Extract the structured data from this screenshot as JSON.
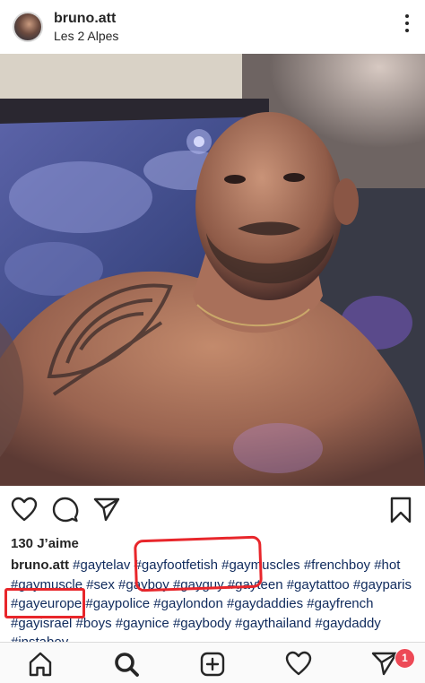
{
  "post": {
    "username": "bruno.att",
    "location": "Les 2 Alpes",
    "likes": "130 J’aime",
    "caption_user": "bruno.att",
    "caption_tags": "#gaytelav  #gayfootfetish #gaymuscles #frenchboy #hot #gaymuscle #sex #gayboy #gayguy #gayteen #gaytattoo #gayparis #gayeurope #gaypolice #gaylondon #gaydaddies #gayfrench #gayisrael #boys #gaynice #gaybody #gaythailand #gaydaddy #instaboy"
  },
  "nav": {
    "notifications_badge": "1"
  },
  "icons": {
    "more": "more-vertical-icon",
    "like": "heart-icon",
    "comment": "comment-icon",
    "share": "send-icon",
    "save": "bookmark-icon",
    "home": "home-icon",
    "search": "search-icon",
    "create": "add-post-icon",
    "activity": "heart-icon",
    "direct": "direct-icon"
  },
  "colors": {
    "annotation": "#e8262b",
    "badge": "#ed4956",
    "hashtag": "#0f2a5c"
  }
}
